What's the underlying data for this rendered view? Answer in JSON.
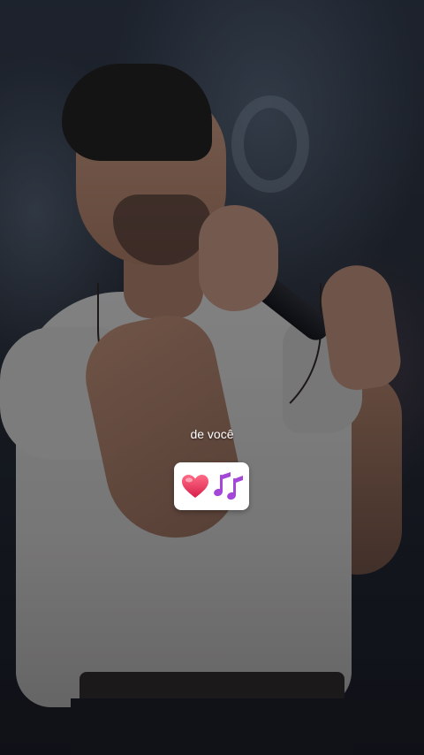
{
  "caption": {
    "text": "de você"
  },
  "sticker": {
    "icons": [
      "heart-icon",
      "music-notes-icon"
    ],
    "heart_color": "#e8365a",
    "notes_color": "#a446d8"
  }
}
